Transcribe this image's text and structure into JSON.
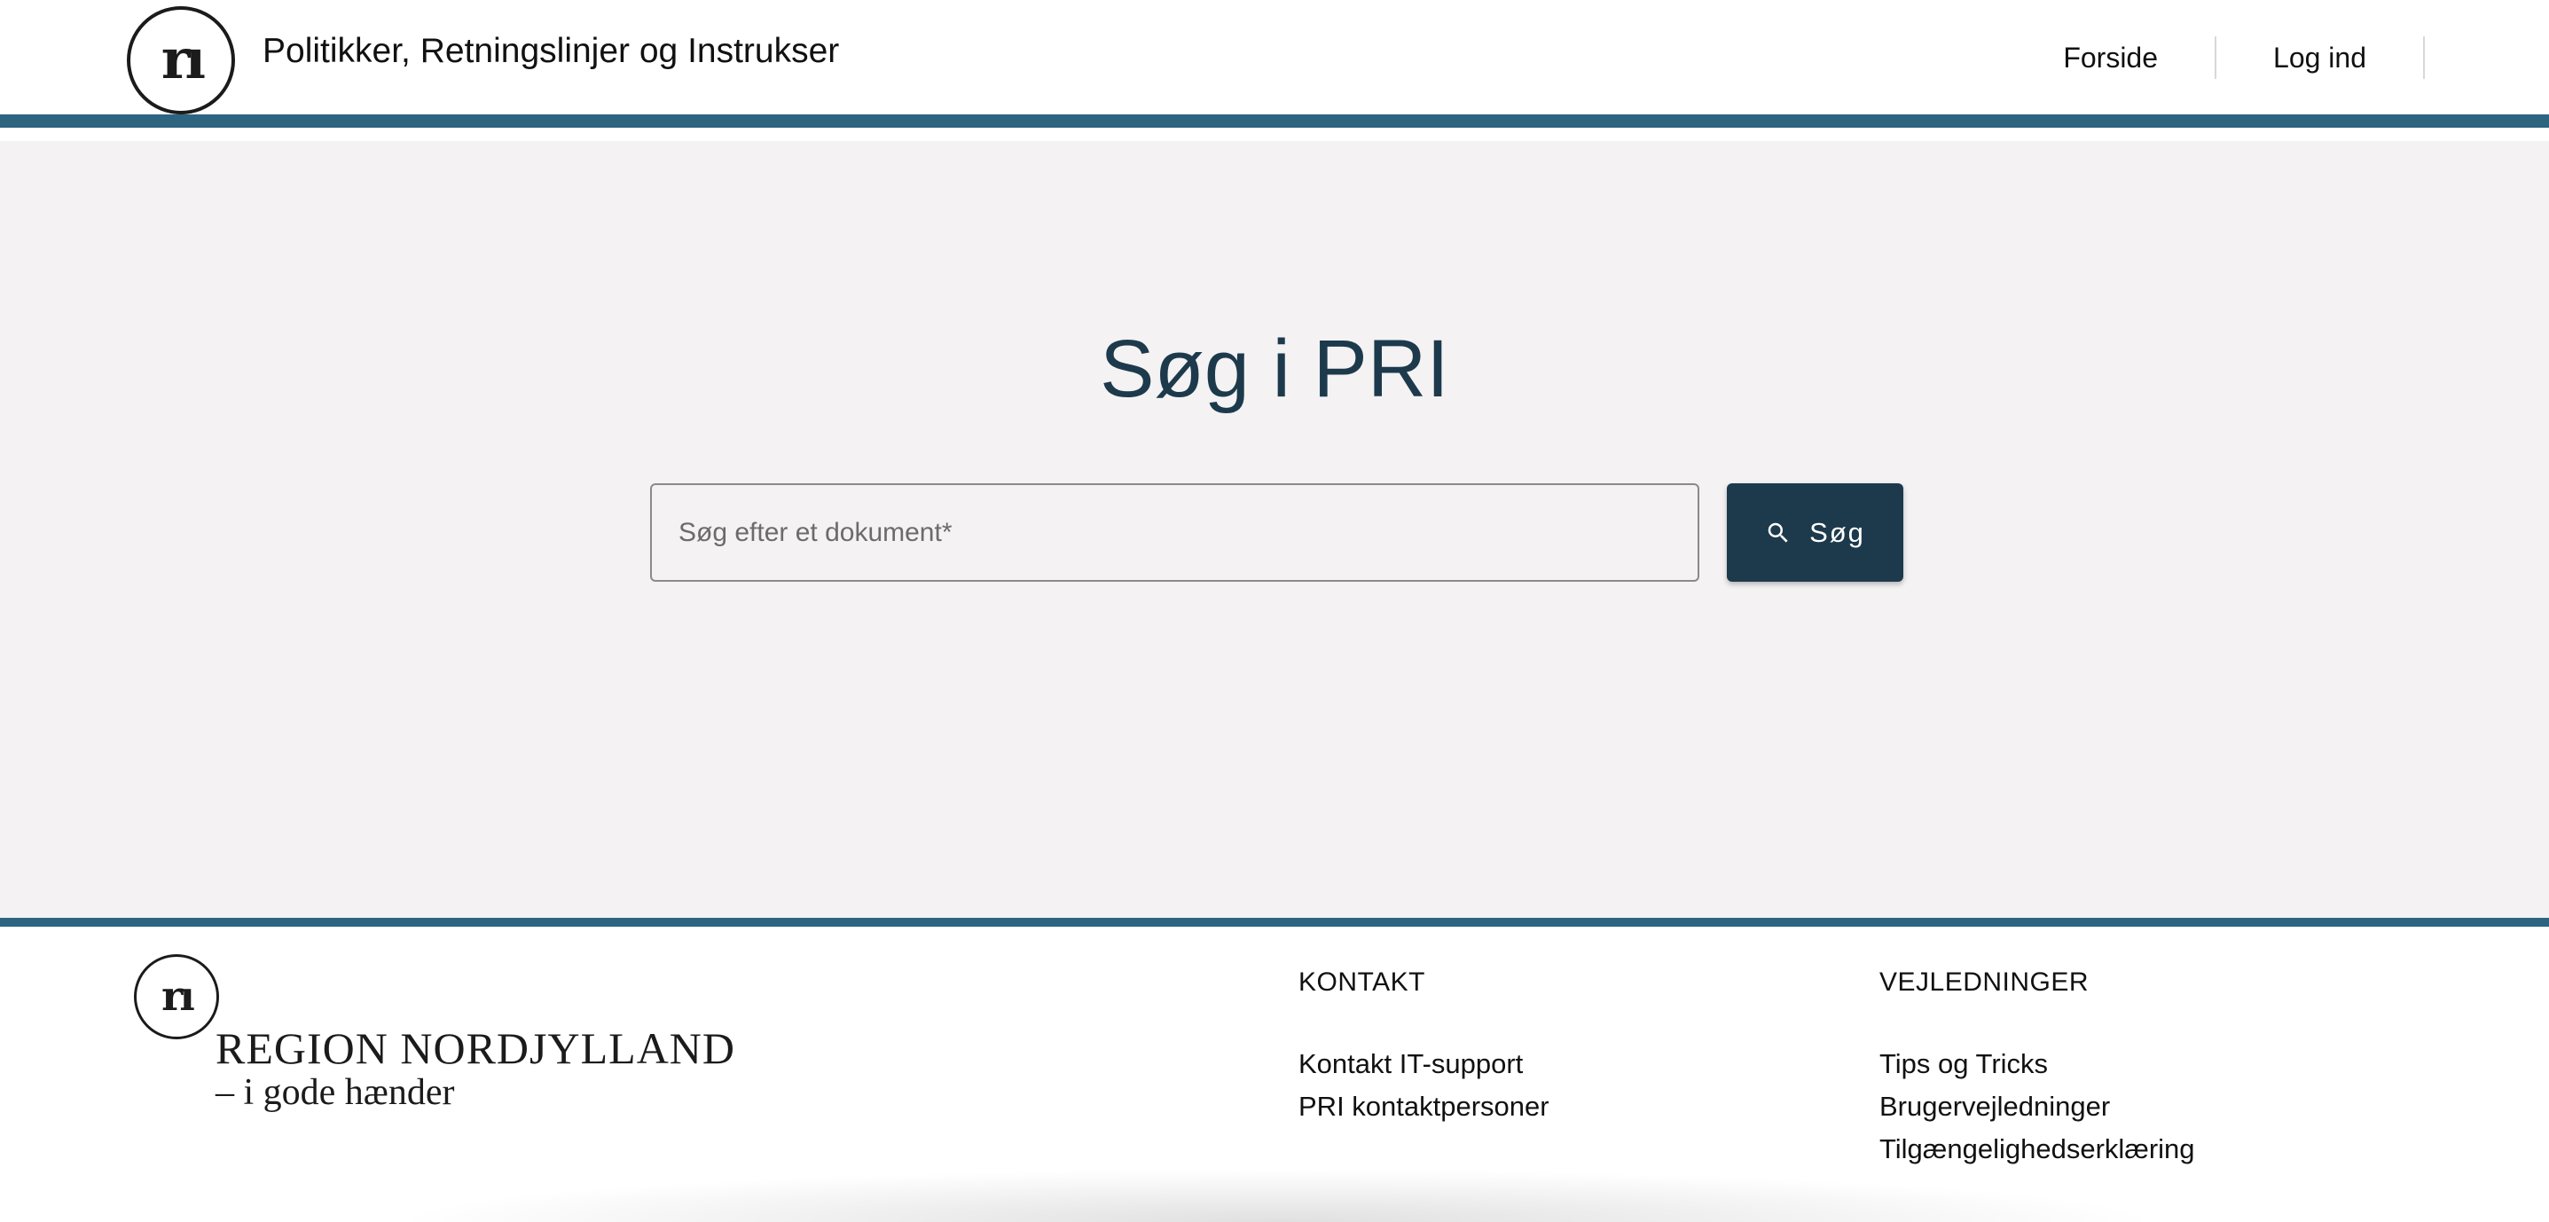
{
  "header": {
    "logo_glyph": "rı",
    "site_title": "Politikker, Retningslinjer og Instrukser",
    "nav": [
      {
        "label": "Forside"
      },
      {
        "label": "Log ind"
      }
    ]
  },
  "hero": {
    "title": "Søg i PRI",
    "search": {
      "placeholder": "Søg efter et dokument*",
      "value": "",
      "button_label": "Søg",
      "button_icon": "search-icon"
    }
  },
  "footer": {
    "logo_glyph": "rı",
    "region_name": "REGION NORDJYLLAND",
    "tagline": "– i gode hænder",
    "kontakt": {
      "heading": "KONTAKT",
      "links": [
        "Kontakt IT-support",
        "PRI kontaktpersoner"
      ]
    },
    "vejledninger": {
      "heading": "VEJLEDNINGER",
      "links": [
        "Tips og Tricks",
        "Brugervejledninger",
        "Tilgængelighedserklæring"
      ]
    }
  },
  "colors": {
    "accent_bar": "#2d6581",
    "primary_dark": "#1d3a4c",
    "hero_background": "#f4f2f3"
  }
}
